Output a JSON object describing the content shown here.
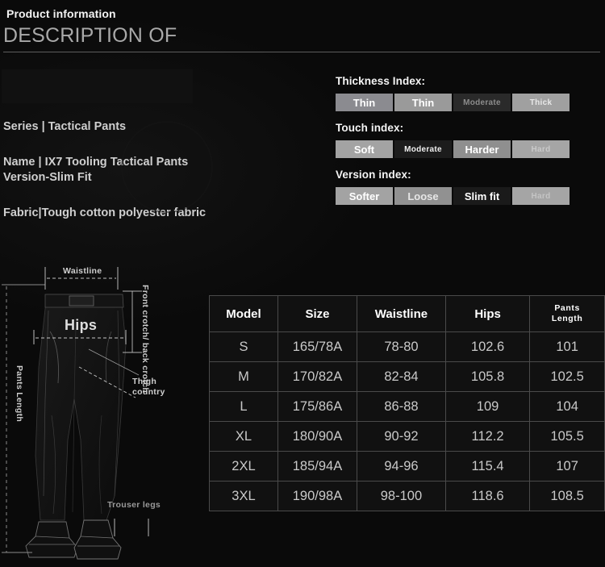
{
  "header": {
    "kicker": "Product information",
    "title": "DESCRIPTION OF"
  },
  "info": {
    "series": "Series | Tactical Pants",
    "name": "Name | IX7 Tooling Tactical Pants Version-Slim Fit",
    "fabric": "Fabric|Tough cotton polyester fabric"
  },
  "indexes": [
    {
      "label": "Thickness Index:",
      "options": [
        {
          "text": "Thin",
          "bg": "#8b8b90",
          "fg": "#ffffff",
          "size": "md"
        },
        {
          "text": "Thin",
          "bg": "#9a9a9a",
          "fg": "#ffffff",
          "size": "md"
        },
        {
          "text": "Moderate",
          "bg": "#2a2a2a",
          "fg": "#8c8c8c",
          "size": "sm"
        },
        {
          "text": "Thick",
          "bg": "#a0a0a0",
          "fg": "#e8e8e8",
          "size": "sm"
        }
      ]
    },
    {
      "label": "Touch index:",
      "options": [
        {
          "text": "Soft",
          "bg": "#a3a3a3",
          "fg": "#ffffff",
          "size": "md"
        },
        {
          "text": "Moderate",
          "bg": "#1c1c1c",
          "fg": "#f0f0f0",
          "size": "sm"
        },
        {
          "text": "Harder",
          "bg": "#8f8f8f",
          "fg": "#ffffff",
          "size": "md"
        },
        {
          "text": "Hard",
          "bg": "#a5a5a5",
          "fg": "#c9c9c9",
          "size": "sm"
        }
      ]
    },
    {
      "label": "Version index:",
      "options": [
        {
          "text": "Softer",
          "bg": "#a3a3a3",
          "fg": "#ffffff",
          "size": "md"
        },
        {
          "text": "Loose",
          "bg": "#919191",
          "fg": "#e6e6e6",
          "size": "md"
        },
        {
          "text": "Slim fit",
          "bg": "#1a1a1a",
          "fg": "#ffffff",
          "size": "md"
        },
        {
          "text": "Hard",
          "bg": "#a5a5a5",
          "fg": "#c4c4c4",
          "size": "sm"
        }
      ]
    }
  ],
  "diagram": {
    "waistline": "Waistline",
    "hips": "Hips",
    "front_back_crotch": "Front crotch/ back crotch",
    "pants_length": "Pants Length",
    "thigh_country": "Thigh country",
    "trouser_legs": "Trouser legs"
  },
  "size_table": {
    "columns": [
      "Model",
      "Size",
      "Waistline",
      "Hips",
      "Pants Length"
    ],
    "rows": [
      [
        "S",
        "165/78A",
        "78-80",
        "102.6",
        "101"
      ],
      [
        "M",
        "170/82A",
        "82-84",
        "105.8",
        "102.5"
      ],
      [
        "L",
        "175/86A",
        "86-88",
        "109",
        "104"
      ],
      [
        "XL",
        "180/90A",
        "90-92",
        "112.2",
        "105.5"
      ],
      [
        "2XL",
        "185/94A",
        "94-96",
        "115.4",
        "107"
      ],
      [
        "3XL",
        "190/98A",
        "98-100",
        "118.6",
        "108.5"
      ]
    ]
  },
  "colors": {
    "background": "#0a0a0a",
    "text_primary": "#f2f2f2",
    "text_secondary": "#a9a9a9",
    "table_border": "#4a4a4a"
  }
}
